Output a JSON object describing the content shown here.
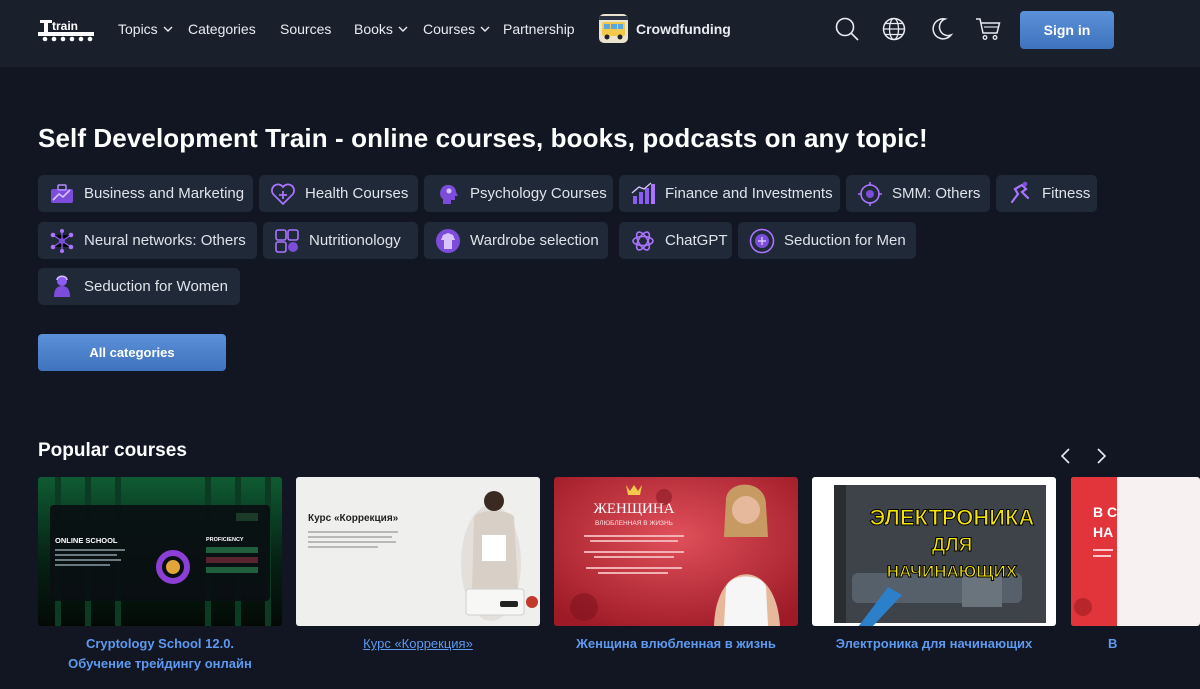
{
  "header": {
    "logo_text": "train",
    "nav": [
      {
        "label": "Topics",
        "dropdown": true
      },
      {
        "label": "Categories",
        "dropdown": false
      },
      {
        "label": "Sources",
        "dropdown": false
      },
      {
        "label": "Books",
        "dropdown": true
      },
      {
        "label": "Courses",
        "dropdown": true
      },
      {
        "label": "Partnership",
        "dropdown": false
      }
    ],
    "crowdfunding_label": "Crowdfunding",
    "icons": [
      "search-icon",
      "globe-icon",
      "moon-icon",
      "cart-icon"
    ],
    "signin_label": "Sign in"
  },
  "hero": {
    "headline": "Self Development Train - online courses, books, podcasts on any topic!",
    "categories": [
      {
        "label": "Business and Marketing",
        "icon": "business-icon"
      },
      {
        "label": "Health Courses",
        "icon": "heart-plus-icon"
      },
      {
        "label": "Psychology Courses",
        "icon": "head-icon"
      },
      {
        "label": "Finance and Investments",
        "icon": "finance-chart-icon"
      },
      {
        "label": "SMM: Others",
        "icon": "smm-icon"
      },
      {
        "label": "Fitness",
        "icon": "fitness-icon"
      },
      {
        "label": "Neural networks: Others",
        "icon": "neural-network-icon"
      },
      {
        "label": "Nutritionology",
        "icon": "nutrition-icon"
      },
      {
        "label": "Wardrobe selection",
        "icon": "wardrobe-icon"
      },
      {
        "label": "ChatGPT",
        "icon": "chatgpt-icon"
      },
      {
        "label": "Seduction for Men",
        "icon": "seduction-men-icon"
      },
      {
        "label": "Seduction for Women",
        "icon": "seduction-women-icon"
      }
    ],
    "all_categories_label": "All categories"
  },
  "popular": {
    "title": "Popular courses",
    "courses": [
      {
        "title_line1": "Cryptology School 12.0.",
        "title_line2": "Обучение трейдингу онлайн",
        "image_text": "ONLINE SCHOOL",
        "image_text2": "PROFICIENCY"
      },
      {
        "title": "Курс «Коррекция»",
        "image_text": "Курс «Коррекция»"
      },
      {
        "title": "Женщина влюбленная в жизнь",
        "image_text": "ЖЕНЩИНА",
        "image_text2": "ВЛЮБЛЕННАЯ В ЖИЗНЬ"
      },
      {
        "title": "Электроника для начинающих",
        "image_text": "ЭЛЕКТРОНИКА",
        "image_text2": "ДЛЯ",
        "image_text3": "НАЧИНАЮЩИХ"
      },
      {
        "title": "В",
        "image_text": "В С",
        "image_text2": "НА"
      }
    ]
  },
  "colors": {
    "background": "#111622",
    "header_bg": "#1a202b",
    "chip_bg": "#202937",
    "accent": "#4a7fcb",
    "link": "#5d9af0",
    "icon_purple": "#8b5cf6"
  }
}
